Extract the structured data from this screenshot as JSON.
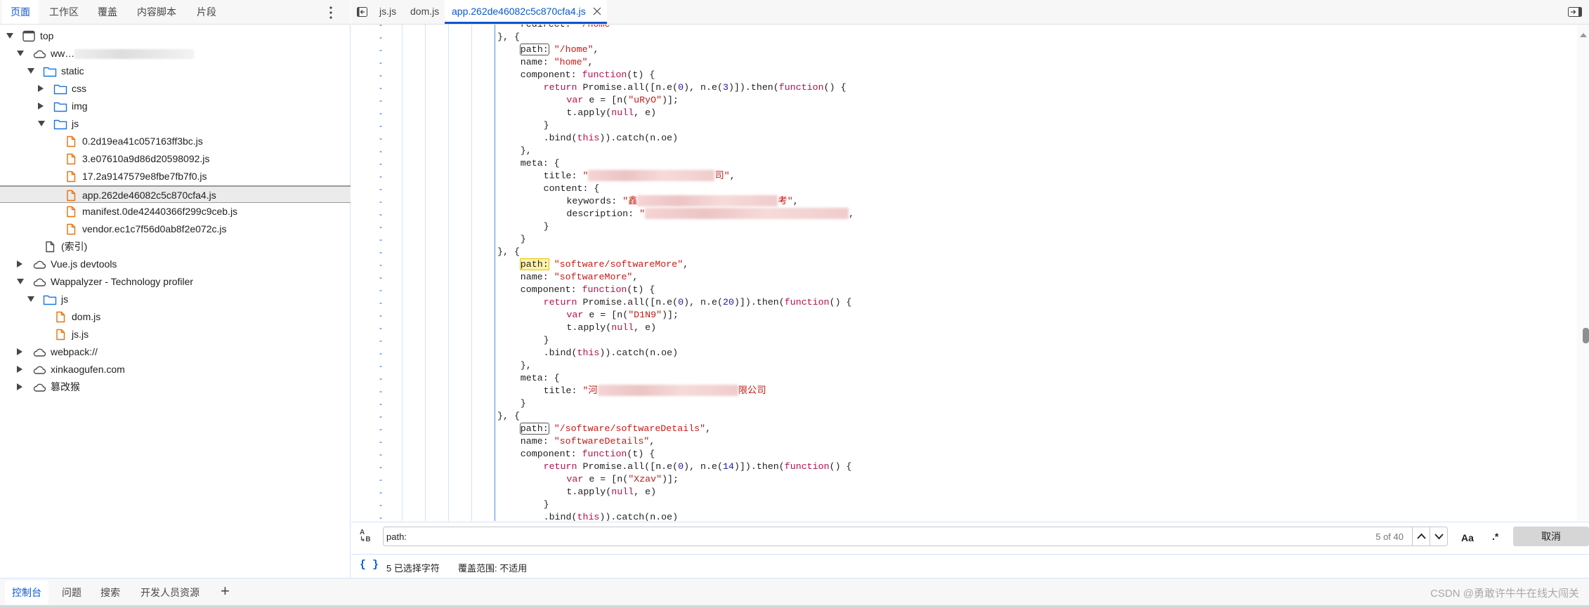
{
  "left_panel": {
    "tabs": [
      {
        "label": "页面",
        "selected": true
      },
      {
        "label": "工作区"
      },
      {
        "label": "覆盖"
      },
      {
        "label": "内容脚本"
      },
      {
        "label": "片段"
      }
    ],
    "menu_icon": "more-vertical-icon",
    "tree": [
      {
        "label": "top",
        "level": 0,
        "icon": "frame-icon",
        "expanded": true
      },
      {
        "label": "ww…",
        "level": 1,
        "icon": "cloud-icon",
        "expanded": true,
        "redacted": true
      },
      {
        "label": "static",
        "level": 2,
        "icon": "folder-icon",
        "expanded": true
      },
      {
        "label": "css",
        "level": 3,
        "icon": "folder-icon",
        "expanded": false
      },
      {
        "label": "img",
        "level": 3,
        "icon": "folder-icon",
        "expanded": false
      },
      {
        "label": "js",
        "level": 3,
        "icon": "folder-icon",
        "expanded": true
      },
      {
        "label": "0.2d19ea41c057163ff3bc.js",
        "level": 4,
        "icon": "js-file-icon"
      },
      {
        "label": "3.e07610a9d86d20598092.js",
        "level": 4,
        "icon": "js-file-icon"
      },
      {
        "label": "17.2a9147579e8fbe7fb7f0.js",
        "level": 4,
        "icon": "js-file-icon"
      },
      {
        "label": "app.262de46082c5c870cfa4.js",
        "level": 4,
        "icon": "js-file-icon",
        "selected": true
      },
      {
        "label": "manifest.0de42440366f299c9ceb.js",
        "level": 4,
        "icon": "js-file-icon"
      },
      {
        "label": "vendor.ec1c7f56d0ab8f2e072c.js",
        "level": 4,
        "icon": "js-file-icon"
      },
      {
        "label": "(索引)",
        "level": 2,
        "icon": "document-icon"
      },
      {
        "label": "Vue.js devtools",
        "level": 1,
        "icon": "cloud-icon",
        "expanded": false
      },
      {
        "label": "Wappalyzer - Technology profiler",
        "level": 1,
        "icon": "cloud-icon",
        "expanded": true
      },
      {
        "label": "js",
        "level": 2,
        "icon": "folder-icon",
        "expanded": true
      },
      {
        "label": "dom.js",
        "level": 3,
        "icon": "js-file-icon"
      },
      {
        "label": "js.js",
        "level": 3,
        "icon": "js-file-icon"
      },
      {
        "label": "webpack://",
        "level": 1,
        "icon": "cloud-icon",
        "expanded": false
      },
      {
        "label": "xinkaogufen.com",
        "level": 1,
        "icon": "cloud-icon",
        "expanded": false
      },
      {
        "label": "篡改猴",
        "level": 1,
        "icon": "cloud-icon",
        "expanded": false
      }
    ]
  },
  "editor": {
    "tabs": [
      {
        "label": "js.js"
      },
      {
        "label": "dom.js"
      },
      {
        "label": "app.262de46082c5c870cfa4.js",
        "active": true,
        "closable": true
      }
    ],
    "line_marker": "-",
    "code_lines": [
      {
        "indent": 5,
        "tokens": [
          [
            "p",
            "redirect: "
          ],
          [
            "s",
            "\"/home\""
          ]
        ]
      },
      {
        "indent": 4,
        "tokens": [
          [
            "p",
            "}, {"
          ]
        ]
      },
      {
        "indent": 5,
        "tokens": [
          [
            "m",
            "path:"
          ],
          [
            "p",
            " "
          ],
          [
            "s",
            "\"/home\""
          ],
          [
            "p",
            ","
          ]
        ]
      },
      {
        "indent": 5,
        "tokens": [
          [
            "p",
            "name: "
          ],
          [
            "s",
            "\"home\""
          ],
          [
            "p",
            ","
          ]
        ]
      },
      {
        "indent": 5,
        "tokens": [
          [
            "p",
            "component: "
          ],
          [
            "k",
            "function"
          ],
          [
            "p",
            "(t) {"
          ]
        ]
      },
      {
        "indent": 6,
        "tokens": [
          [
            "k",
            "return"
          ],
          [
            "p",
            " Promise.all([n.e("
          ],
          [
            "n",
            "0"
          ],
          [
            "p",
            "), n.e("
          ],
          [
            "n",
            "3"
          ],
          [
            "p",
            ")]).then("
          ],
          [
            "k",
            "function"
          ],
          [
            "p",
            "() {"
          ]
        ]
      },
      {
        "indent": 7,
        "tokens": [
          [
            "k",
            "var"
          ],
          [
            "p",
            " e = [n("
          ],
          [
            "s",
            "\"uRyO\""
          ],
          [
            "p",
            ")];"
          ]
        ]
      },
      {
        "indent": 7,
        "tokens": [
          [
            "p",
            "t.apply("
          ],
          [
            "k",
            "null"
          ],
          [
            "p",
            ", e)"
          ]
        ]
      },
      {
        "indent": 6,
        "tokens": [
          [
            "p",
            "}"
          ]
        ]
      },
      {
        "indent": 6,
        "tokens": [
          [
            "p",
            ".bind("
          ],
          [
            "k",
            "this"
          ],
          [
            "p",
            "))."
          ],
          [
            "p",
            "catch(n.oe)"
          ]
        ]
      },
      {
        "indent": 5,
        "tokens": [
          [
            "p",
            "},"
          ]
        ]
      },
      {
        "indent": 5,
        "tokens": [
          [
            "p",
            "meta: {"
          ]
        ]
      },
      {
        "indent": 6,
        "tokens": [
          [
            "p",
            "title: "
          ],
          [
            "s",
            "\""
          ],
          [
            "r",
            "180"
          ],
          [
            "s",
            "司\""
          ],
          [
            "p",
            ","
          ]
        ]
      },
      {
        "indent": 6,
        "tokens": [
          [
            "p",
            "content: {"
          ]
        ]
      },
      {
        "indent": 7,
        "tokens": [
          [
            "p",
            "keywords: "
          ],
          [
            "s",
            "\"鑫"
          ],
          [
            "r",
            "200"
          ],
          [
            "s",
            "考\""
          ],
          [
            "p",
            ","
          ]
        ]
      },
      {
        "indent": 7,
        "tokens": [
          [
            "p",
            "description: "
          ],
          [
            "s",
            "\""
          ],
          [
            "r",
            "290"
          ],
          [
            "p",
            ","
          ]
        ]
      },
      {
        "indent": 6,
        "tokens": [
          [
            "p",
            "}"
          ]
        ]
      },
      {
        "indent": 5,
        "tokens": [
          [
            "p",
            "}"
          ]
        ]
      },
      {
        "indent": 4,
        "tokens": [
          [
            "p",
            "}, {"
          ]
        ]
      },
      {
        "indent": 5,
        "tokens": [
          [
            "c",
            "path:"
          ],
          [
            "p",
            " "
          ],
          [
            "s",
            "\"software/softwareMore\""
          ],
          [
            "p",
            ","
          ]
        ]
      },
      {
        "indent": 5,
        "tokens": [
          [
            "p",
            "name: "
          ],
          [
            "s",
            "\"softwareMore\""
          ],
          [
            "p",
            ","
          ]
        ]
      },
      {
        "indent": 5,
        "tokens": [
          [
            "p",
            "component: "
          ],
          [
            "k",
            "function"
          ],
          [
            "p",
            "(t) {"
          ]
        ]
      },
      {
        "indent": 6,
        "tokens": [
          [
            "k",
            "return"
          ],
          [
            "p",
            " Promise.all([n.e("
          ],
          [
            "n",
            "0"
          ],
          [
            "p",
            "), n.e("
          ],
          [
            "n",
            "20"
          ],
          [
            "p",
            ")]).then("
          ],
          [
            "k",
            "function"
          ],
          [
            "p",
            "() {"
          ]
        ]
      },
      {
        "indent": 7,
        "tokens": [
          [
            "k",
            "var"
          ],
          [
            "p",
            " e = [n("
          ],
          [
            "s",
            "\"D1N9\""
          ],
          [
            "p",
            ")];"
          ]
        ]
      },
      {
        "indent": 7,
        "tokens": [
          [
            "p",
            "t.apply("
          ],
          [
            "k",
            "null"
          ],
          [
            "p",
            ", e)"
          ]
        ]
      },
      {
        "indent": 6,
        "tokens": [
          [
            "p",
            "}"
          ]
        ]
      },
      {
        "indent": 6,
        "tokens": [
          [
            "p",
            ".bind("
          ],
          [
            "k",
            "this"
          ],
          [
            "p",
            ")).catch(n.oe)"
          ]
        ]
      },
      {
        "indent": 5,
        "tokens": [
          [
            "p",
            "},"
          ]
        ]
      },
      {
        "indent": 5,
        "tokens": [
          [
            "p",
            "meta: {"
          ]
        ]
      },
      {
        "indent": 6,
        "tokens": [
          [
            "p",
            "title: "
          ],
          [
            "s",
            "\"河"
          ],
          [
            "r",
            "200"
          ],
          [
            "s",
            "限公司"
          ]
        ]
      },
      {
        "indent": 5,
        "tokens": [
          [
            "p",
            "}"
          ]
        ]
      },
      {
        "indent": 4,
        "tokens": [
          [
            "p",
            "}, {"
          ]
        ]
      },
      {
        "indent": 5,
        "tokens": [
          [
            "m",
            "path:"
          ],
          [
            "p",
            " "
          ],
          [
            "s",
            "\"/software/softwareDetails\""
          ],
          [
            "p",
            ","
          ]
        ]
      },
      {
        "indent": 5,
        "tokens": [
          [
            "p",
            "name: "
          ],
          [
            "s",
            "\"softwareDetails\""
          ],
          [
            "p",
            ","
          ]
        ]
      },
      {
        "indent": 5,
        "tokens": [
          [
            "p",
            "component: "
          ],
          [
            "k",
            "function"
          ],
          [
            "p",
            "(t) {"
          ]
        ]
      },
      {
        "indent": 6,
        "tokens": [
          [
            "k",
            "return"
          ],
          [
            "p",
            " Promise.all([n.e("
          ],
          [
            "n",
            "0"
          ],
          [
            "p",
            "), n.e("
          ],
          [
            "n",
            "14"
          ],
          [
            "p",
            ")]).then("
          ],
          [
            "k",
            "function"
          ],
          [
            "p",
            "() {"
          ]
        ]
      },
      {
        "indent": 7,
        "tokens": [
          [
            "k",
            "var"
          ],
          [
            "p",
            " e = [n("
          ],
          [
            "s",
            "\"Xzav\""
          ],
          [
            "p",
            ")];"
          ]
        ]
      },
      {
        "indent": 7,
        "tokens": [
          [
            "p",
            "t.apply("
          ],
          [
            "k",
            "null"
          ],
          [
            "p",
            ", e)"
          ]
        ]
      },
      {
        "indent": 6,
        "tokens": [
          [
            "p",
            "}"
          ]
        ]
      },
      {
        "indent": 6,
        "tokens": [
          [
            "p",
            ".bind("
          ],
          [
            "k",
            "this"
          ],
          [
            "p",
            ")).catch(n.oe)"
          ]
        ]
      }
    ]
  },
  "search": {
    "value": "path:",
    "match_count": "5 of 40",
    "case_label": "Aa",
    "regex_label": ".*",
    "cancel_label": "取消"
  },
  "status": {
    "selected": "5 已选择字符",
    "coverage": "覆盖范围: 不适用"
  },
  "drawer": {
    "tabs": [
      {
        "label": "控制台",
        "selected": true
      },
      {
        "label": "问题"
      },
      {
        "label": "搜索"
      },
      {
        "label": "开发人员资源"
      }
    ],
    "add_label": "+"
  },
  "watermark": "CSDN @勇敢许牛牛在线大闯关",
  "colors": {
    "accent": "#0b57d0",
    "string": "#c41a16",
    "keyword": "#b5104e",
    "number": "#1a1aa6",
    "match_highlight": "#fff2a8"
  }
}
